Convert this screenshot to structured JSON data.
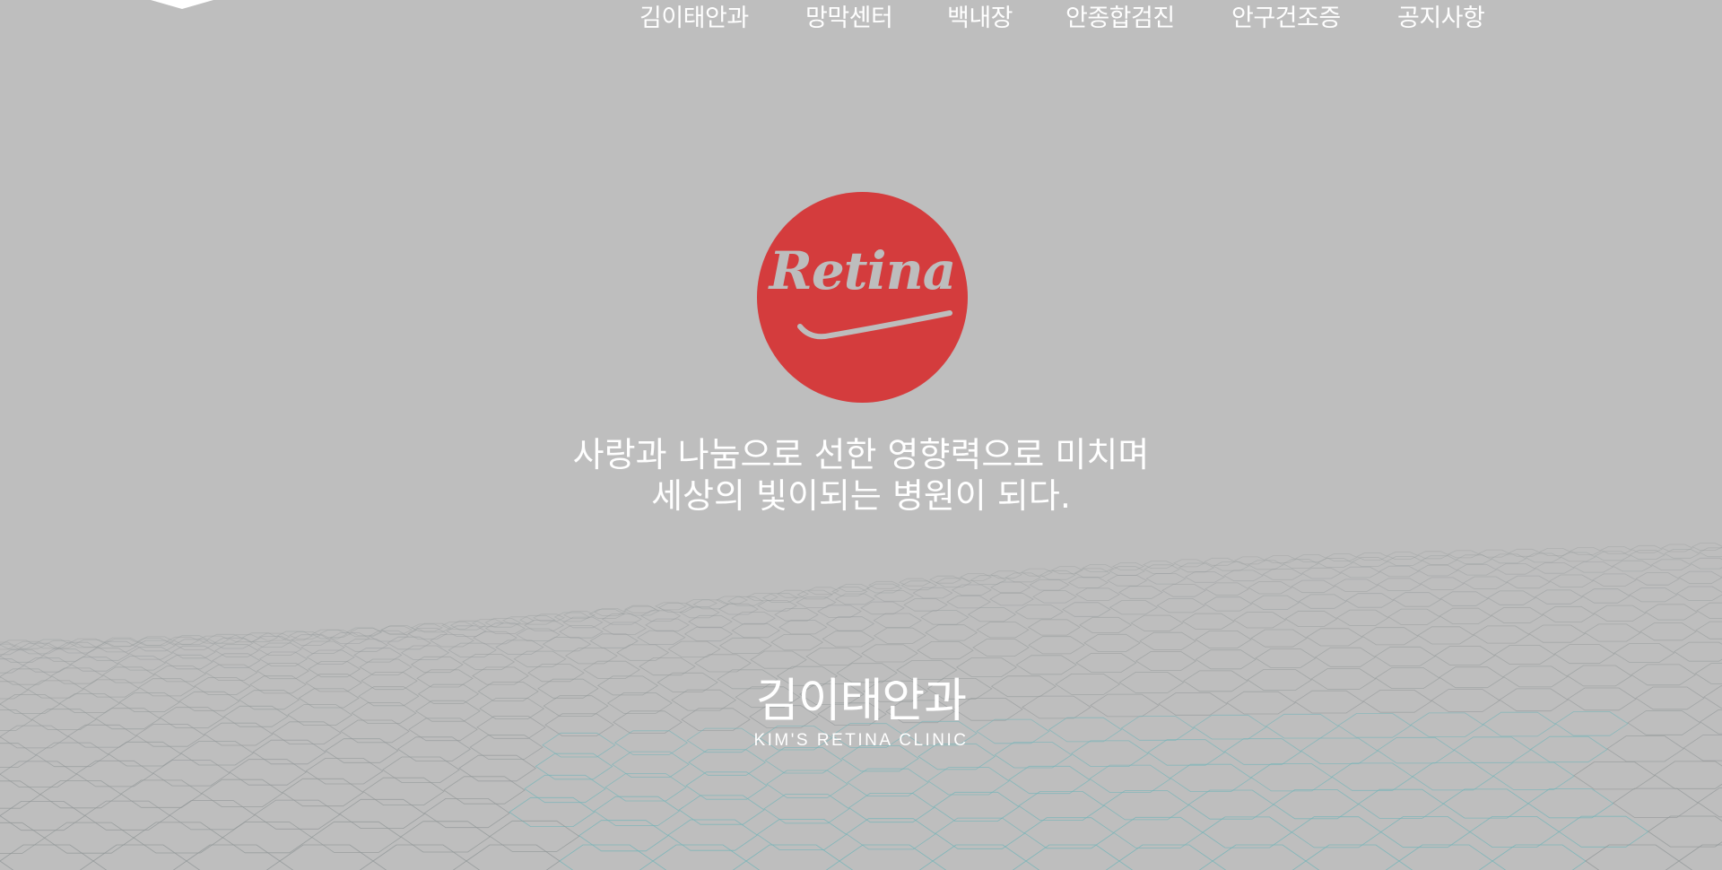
{
  "colors": {
    "background": "#bebebe",
    "badge": "#d43c3d",
    "text": "#ffffff",
    "mesh_line": "#8f9596",
    "mesh_accent": "#6fb4b8"
  },
  "nav": {
    "items": [
      {
        "label": "김이태안과"
      },
      {
        "label": "망막센터"
      },
      {
        "label": "백내장"
      },
      {
        "label": "안종합검진"
      },
      {
        "label": "안구건조증"
      },
      {
        "label": "공지사항"
      }
    ]
  },
  "hero": {
    "badge_text": "Retina",
    "tagline_line1": "사랑과 나눔으로 선한 영향력으로 미치며",
    "tagline_line2": "세상의 빛이되는 병원이 되다."
  },
  "brand": {
    "name_ko": "김이태안과",
    "name_en": "KIM'S RETINA CLINIC"
  }
}
